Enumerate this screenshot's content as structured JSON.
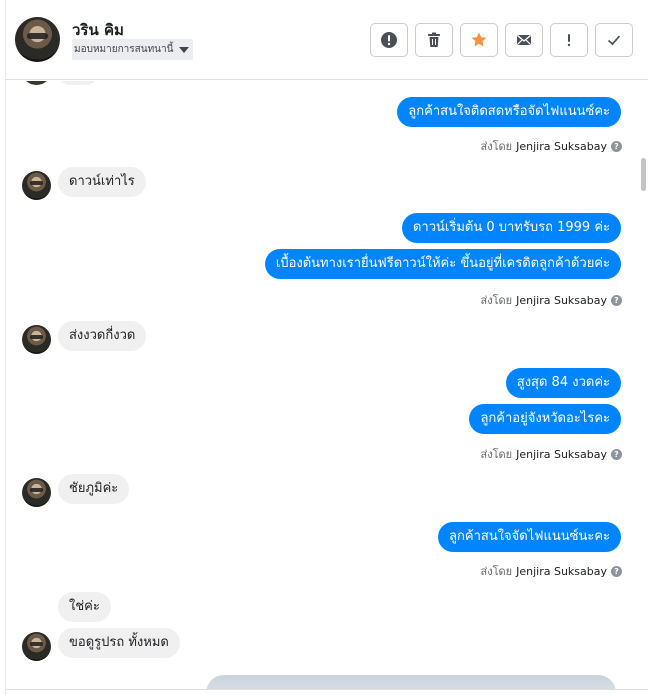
{
  "header": {
    "contact_name": "วริน คิม",
    "assign_label": "มอบหมายการสนทนานี้",
    "toolbar": [
      {
        "name": "spam-button",
        "icon": "alert-circle-icon"
      },
      {
        "name": "delete-button",
        "icon": "trash-icon"
      },
      {
        "name": "star-button",
        "icon": "star-icon"
      },
      {
        "name": "mark-unread-button",
        "icon": "envelope-icon"
      },
      {
        "name": "follow-up-button",
        "icon": "exclamation-icon"
      },
      {
        "name": "mark-done-button",
        "icon": "checkmark-icon"
      }
    ],
    "colors": {
      "star": "#f7923a",
      "icon": "#4b4f56"
    }
  },
  "sent_prefix": "ส่งโดย",
  "agent_name": "Jenjira Suksabay",
  "help_glyph": "?",
  "messages": [
    {
      "from": "page",
      "text": "ลูกค้าสนใจติดสดหรือจัดไฟแนนซ์คะ"
    },
    {
      "from": "customer",
      "text": "ดาวน์เท่าไร"
    },
    {
      "from": "page",
      "text": "ดาวน์เริ่มต้น 0 บาทรับรถ 1999 ค่ะ"
    },
    {
      "from": "page",
      "text": "เบื้องต้นทางเรายื่นฟรีดาวน์ให้ค่ะ ขึ้นอยู่ที่เครดิตลูกค้าด้วยค่ะ"
    },
    {
      "from": "customer",
      "text": "ส่งงวดกี่งวด"
    },
    {
      "from": "page",
      "text": "สูงสุด 84 งวดค่ะ"
    },
    {
      "from": "page",
      "text": "ลูกค้าอยู่จังหวัดอะไรคะ"
    },
    {
      "from": "customer",
      "text": "ชัยภูมิค่ะ"
    },
    {
      "from": "page",
      "text": "ลูกค้าสนใจจัดไฟแนนซ์นะคะ"
    },
    {
      "from": "customer",
      "text": "ใช่ค่ะ"
    },
    {
      "from": "customer",
      "text": "ขอดูรูปรถ ทั้งหมด"
    }
  ],
  "colors": {
    "outgoing": "#0084ff",
    "incoming": "#f0f0f0"
  }
}
